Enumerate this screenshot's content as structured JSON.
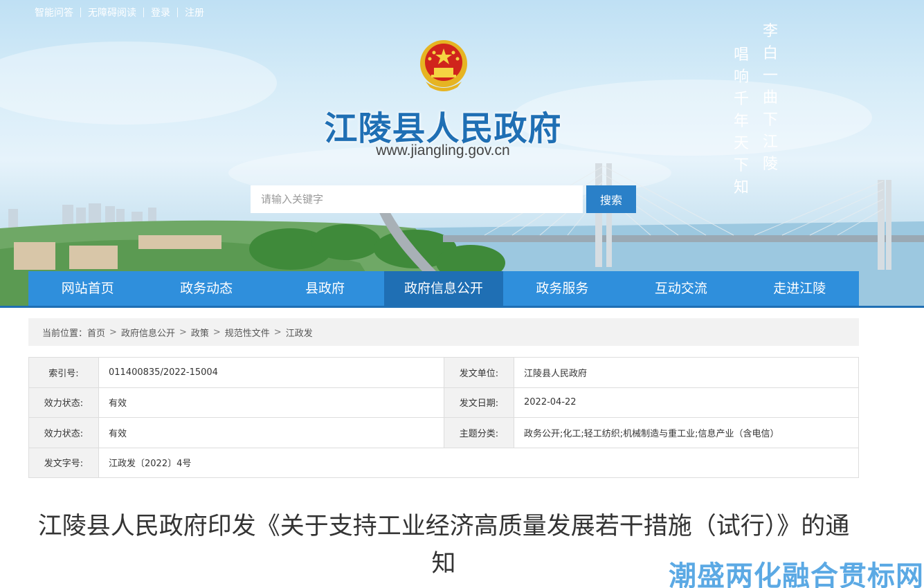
{
  "toplinks": [
    "智能问答",
    "无障碍阅读",
    "登录",
    "注册"
  ],
  "site": {
    "title": "江陵县人民政府",
    "url": "www.jiangling.gov.cn"
  },
  "search": {
    "placeholder": "请输入关键字",
    "button": "搜索"
  },
  "poem": {
    "col1": "李白一曲下江陵",
    "col2": "唱响千年天下知"
  },
  "nav": [
    "网站首页",
    "政务动态",
    "县政府",
    "政府信息公开",
    "政务服务",
    "互动交流",
    "走进江陵"
  ],
  "nav_active": "政府信息公开",
  "breadcrumb": {
    "label": "当前位置：",
    "items": [
      "首页",
      "政府信息公开",
      "政策",
      "规范性文件",
      "江政发"
    ]
  },
  "info": {
    "index_label": "索引号:",
    "index_value": "011400835/2022-15004",
    "issuer_label": "发文单位:",
    "issuer_value": "江陵县人民政府",
    "status_label": "效力状态:",
    "status_value": "有效",
    "date_label": "发文日期:",
    "date_value": "2022-04-22",
    "status2_label": "效力状态:",
    "status2_value": "有效",
    "topic_label": "主题分类:",
    "topic_value": "政务公开;化工;轻工纺织;机械制造与重工业;信息产业（含电信）",
    "docno_label": "发文字号:",
    "docno_value": "江政发〔2022〕4号"
  },
  "article": {
    "title": "江陵县人民政府印发《关于支持工业经济高质量发展若干措施（试行）》的通知"
  },
  "watermark": "潮盛两化融合贯标网",
  "colors": {
    "nav": "#2f8fdc",
    "nav_active": "#1f6fb4",
    "title_blue": "#1f6fb4",
    "emblem_red": "#d0241c",
    "emblem_gold": "#e6b422"
  }
}
